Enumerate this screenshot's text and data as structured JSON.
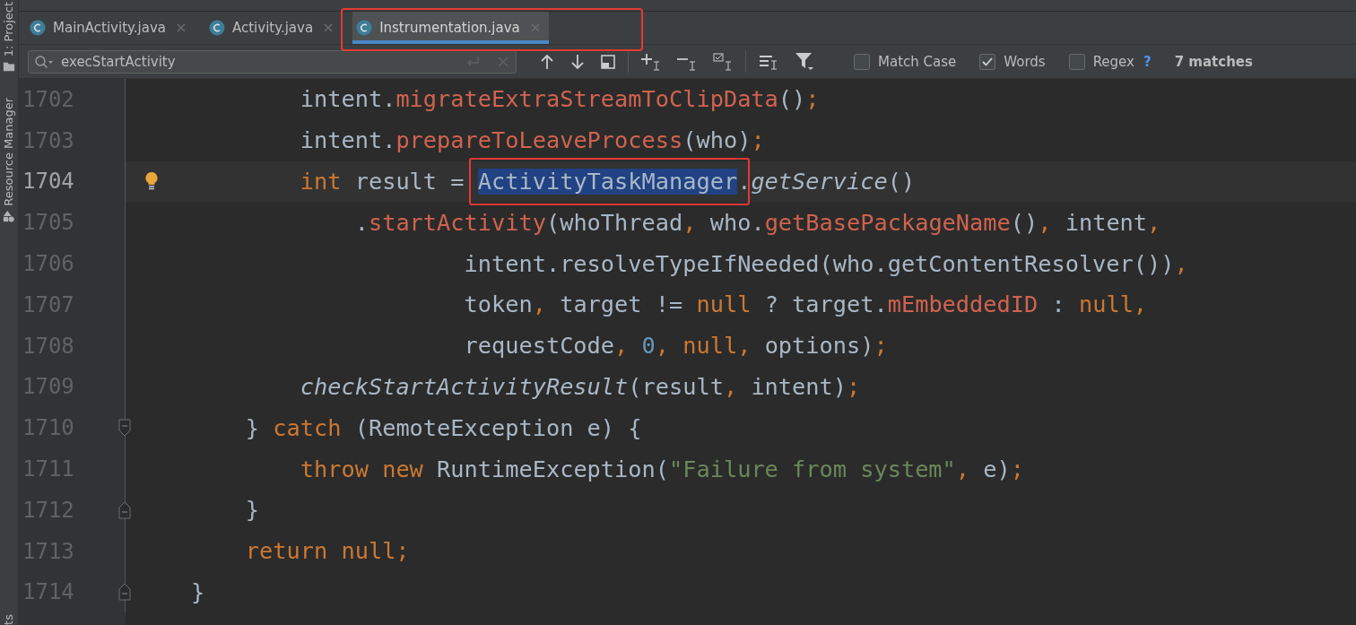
{
  "side_strip": [
    {
      "label": "1: Project"
    },
    {
      "label": "Resource Manager"
    },
    {
      "label": "ts"
    }
  ],
  "tabs": [
    {
      "label": "MainActivity.java",
      "selected": false,
      "annotated": false
    },
    {
      "label": "Activity.java",
      "selected": false,
      "annotated": false
    },
    {
      "label": "Instrumentation.java",
      "selected": true,
      "annotated": true
    }
  ],
  "search": {
    "value": "execStartActivity"
  },
  "options": [
    {
      "label": "Match Case",
      "checked": false
    },
    {
      "label": "Words",
      "checked": true
    },
    {
      "label": "Regex",
      "checked": false
    }
  ],
  "help": "?",
  "match_count": "7 matches",
  "lines": [
    {
      "number": "1702",
      "current": false,
      "tokens": [
        {
          "text": "            intent.",
          "kind": "plain"
        },
        {
          "text": "migrateExtraStreamToClipData",
          "kind": "method"
        },
        {
          "text": "()",
          "kind": "plain"
        },
        {
          "text": ";",
          "kind": "keyword"
        }
      ]
    },
    {
      "number": "1703",
      "current": false,
      "tokens": [
        {
          "text": "            intent.",
          "kind": "plain"
        },
        {
          "text": "prepareToLeaveProcess",
          "kind": "method"
        },
        {
          "text": "(who)",
          "kind": "plain"
        },
        {
          "text": ";",
          "kind": "keyword"
        }
      ]
    },
    {
      "number": "1704",
      "current": true,
      "marker": {
        "kind": "bulb"
      },
      "tokens": [
        {
          "text": "            int",
          "kind": "keyword"
        },
        {
          "text": " result = ",
          "kind": "plain"
        },
        {
          "text": "ActivityTaskManager",
          "kind": "selected",
          "annotated": true
        },
        {
          "text": ".",
          "kind": "plain"
        },
        {
          "text": "getService",
          "kind": "static"
        },
        {
          "text": "()",
          "kind": "plain"
        }
      ]
    },
    {
      "number": "1705",
      "current": false,
      "tokens": [
        {
          "text": "                .",
          "kind": "plain"
        },
        {
          "text": "startActivity",
          "kind": "method"
        },
        {
          "text": "(whoThread",
          "kind": "plain"
        },
        {
          "text": ", ",
          "kind": "keyword"
        },
        {
          "text": "who.",
          "kind": "plain"
        },
        {
          "text": "getBasePackageName",
          "kind": "method"
        },
        {
          "text": "()",
          "kind": "plain"
        },
        {
          "text": ", ",
          "kind": "keyword"
        },
        {
          "text": "intent",
          "kind": "plain"
        },
        {
          "text": ",",
          "kind": "keyword"
        }
      ]
    },
    {
      "number": "1706",
      "current": false,
      "tokens": [
        {
          "text": "                        intent.resolveTypeIfNeeded(who.getContentResolver())",
          "kind": "plain"
        },
        {
          "text": ",",
          "kind": "keyword"
        }
      ]
    },
    {
      "number": "1707",
      "current": false,
      "tokens": [
        {
          "text": "                        token",
          "kind": "plain"
        },
        {
          "text": ", ",
          "kind": "keyword"
        },
        {
          "text": "target != ",
          "kind": "plain"
        },
        {
          "text": "null",
          "kind": "keyword"
        },
        {
          "text": " ? target.",
          "kind": "plain"
        },
        {
          "text": "mEmbeddedID",
          "kind": "method"
        },
        {
          "text": " : ",
          "kind": "plain"
        },
        {
          "text": "null,",
          "kind": "keyword"
        }
      ]
    },
    {
      "number": "1708",
      "current": false,
      "tokens": [
        {
          "text": "                        requestCode",
          "kind": "plain"
        },
        {
          "text": ", ",
          "kind": "keyword"
        },
        {
          "text": "0",
          "kind": "number"
        },
        {
          "text": ", ",
          "kind": "keyword"
        },
        {
          "text": "null, ",
          "kind": "keyword"
        },
        {
          "text": "options)",
          "kind": "plain"
        },
        {
          "text": ";",
          "kind": "keyword"
        }
      ]
    },
    {
      "number": "1709",
      "current": false,
      "tokens": [
        {
          "text": "            checkStartActivityResult",
          "kind": "static"
        },
        {
          "text": "(result",
          "kind": "plain"
        },
        {
          "text": ", ",
          "kind": "keyword"
        },
        {
          "text": "intent)",
          "kind": "plain"
        },
        {
          "text": ";",
          "kind": "keyword"
        }
      ]
    },
    {
      "number": "1710",
      "current": false,
      "marker": {
        "kind": "fold_start"
      },
      "tokens": [
        {
          "text": "        } ",
          "kind": "plain"
        },
        {
          "text": "catch",
          "kind": "keyword"
        },
        {
          "text": " (RemoteException e) {",
          "kind": "plain"
        }
      ]
    },
    {
      "number": "1711",
      "current": false,
      "tokens": [
        {
          "text": "            throw new",
          "kind": "keyword"
        },
        {
          "text": " RuntimeException(",
          "kind": "plain"
        },
        {
          "text": "\"Failure from system\"",
          "kind": "string"
        },
        {
          "text": ", ",
          "kind": "keyword"
        },
        {
          "text": "e)",
          "kind": "plain"
        },
        {
          "text": ";",
          "kind": "keyword"
        }
      ]
    },
    {
      "number": "1712",
      "current": false,
      "marker": {
        "kind": "fold_end"
      },
      "tokens": [
        {
          "text": "        }",
          "kind": "plain"
        }
      ]
    },
    {
      "number": "1713",
      "current": false,
      "tokens": [
        {
          "text": "        return null;",
          "kind": "keyword"
        }
      ]
    },
    {
      "number": "1714",
      "current": false,
      "marker": {
        "kind": "fold_end"
      },
      "tokens": [
        {
          "text": "    }",
          "kind": "plain"
        }
      ]
    }
  ]
}
